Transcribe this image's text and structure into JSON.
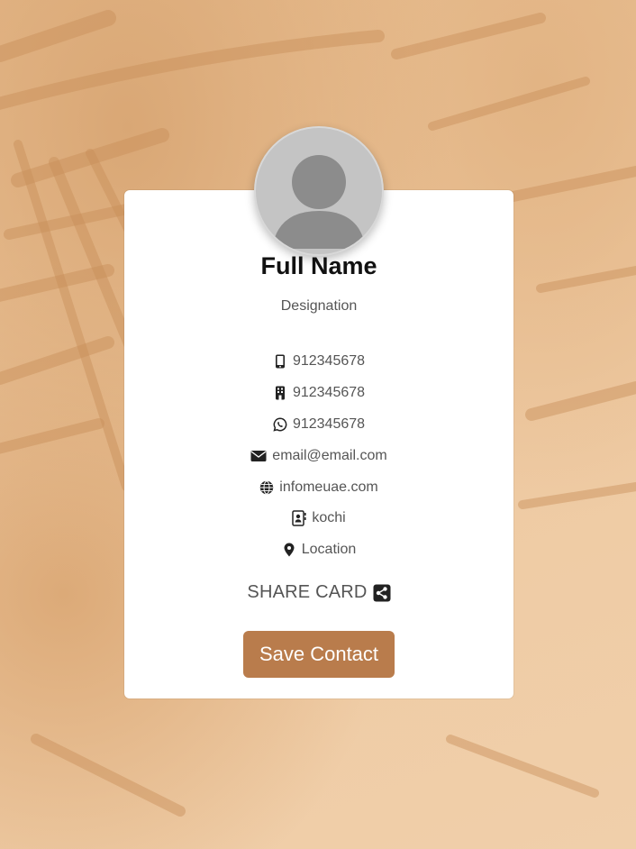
{
  "profile": {
    "name": "Full Name",
    "designation": "Designation"
  },
  "contacts": [
    {
      "icon": "mobile-phone-icon",
      "value": "912345678"
    },
    {
      "icon": "office-building-icon",
      "value": "912345678"
    },
    {
      "icon": "whatsapp-icon",
      "value": "912345678"
    },
    {
      "icon": "envelope-icon",
      "value": "email@email.com"
    },
    {
      "icon": "globe-icon",
      "value": "infomeuae.com"
    },
    {
      "icon": "address-book-icon",
      "value": "kochi"
    },
    {
      "icon": "map-pin-icon",
      "value": "Location"
    }
  ],
  "share": {
    "label": "SHARE CARD",
    "icon": "share-icon"
  },
  "actions": {
    "save_label": "Save Contact"
  },
  "colors": {
    "accent": "#b97c4c",
    "background": "#eec9a0",
    "card": "#ffffff",
    "avatar": "#c4c4c4"
  }
}
